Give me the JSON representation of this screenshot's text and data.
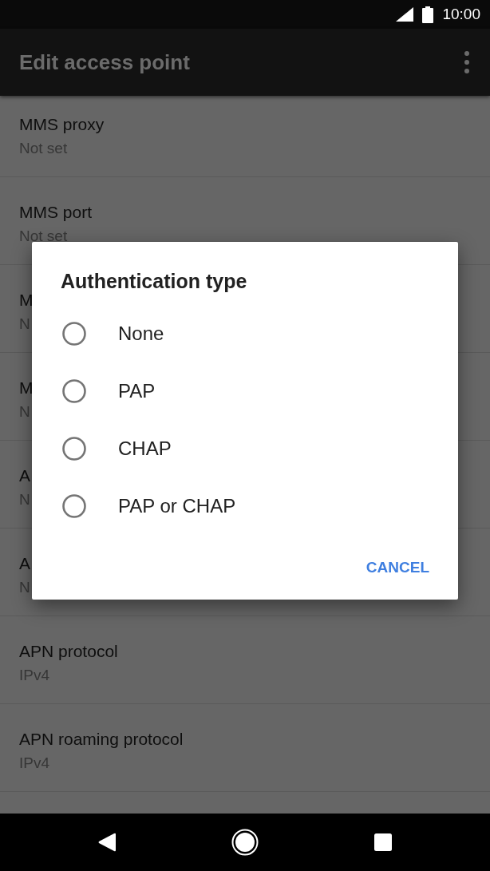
{
  "status_bar": {
    "time": "10:00"
  },
  "app_bar": {
    "title": "Edit access point"
  },
  "settings_list": [
    {
      "title": "MMS proxy",
      "value": "Not set"
    },
    {
      "title": "MMS port",
      "value": "Not set"
    },
    {
      "title": "M",
      "value": "N"
    },
    {
      "title": "M",
      "value": "N"
    },
    {
      "title": "A",
      "value": "N"
    },
    {
      "title": "A",
      "value": "N"
    },
    {
      "title": "APN protocol",
      "value": "IPv4"
    },
    {
      "title": "APN roaming protocol",
      "value": "IPv4"
    }
  ],
  "dialog": {
    "title": "Authentication type",
    "options": [
      {
        "label": "None",
        "selected": false
      },
      {
        "label": "PAP",
        "selected": false
      },
      {
        "label": "CHAP",
        "selected": false
      },
      {
        "label": "PAP or CHAP",
        "selected": false
      }
    ],
    "buttons": [
      "CANCEL"
    ]
  }
}
